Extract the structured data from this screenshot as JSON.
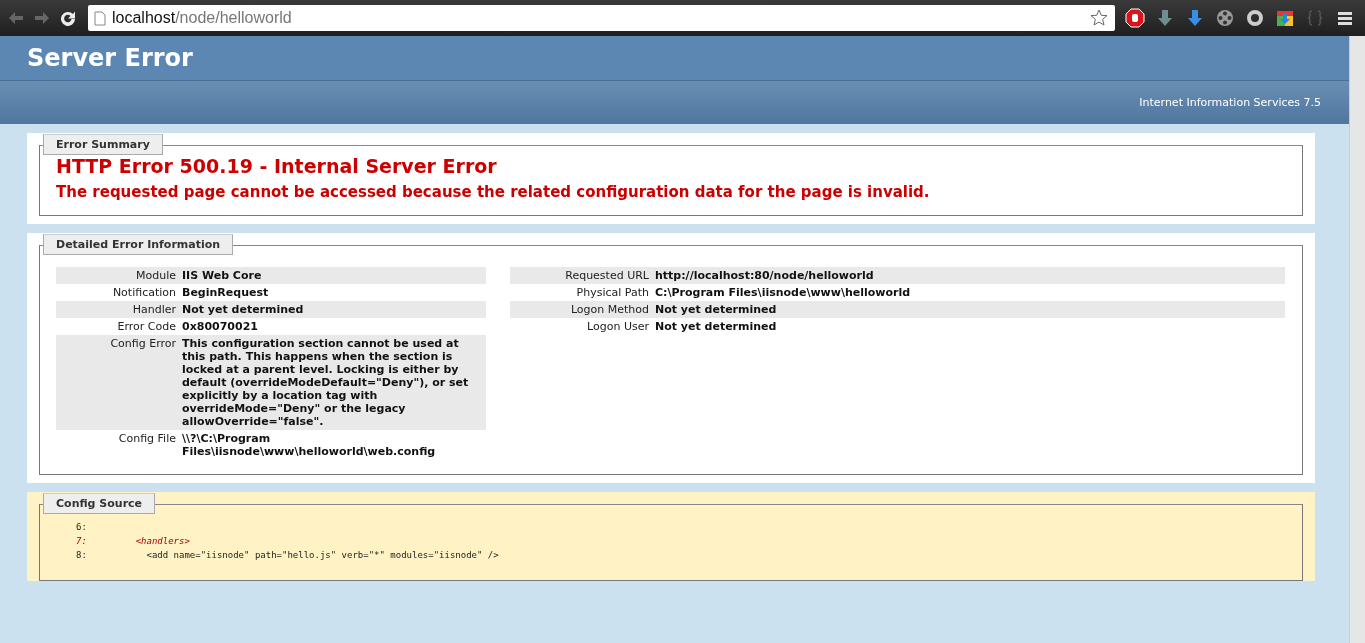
{
  "browser": {
    "url_host": "localhost",
    "url_path": "/node/helloworld"
  },
  "header": {
    "title": "Server Error",
    "subtitle": "Internet Information Services 7.5"
  },
  "error_summary": {
    "legend": "Error Summary",
    "heading": "HTTP Error 500.19 - Internal Server Error",
    "message": "The requested page cannot be accessed because the related configuration data for the page is invalid."
  },
  "detailed_error": {
    "legend": "Detailed Error Information",
    "left": [
      {
        "label": "Module",
        "value": "IIS Web Core"
      },
      {
        "label": "Notification",
        "value": "BeginRequest"
      },
      {
        "label": "Handler",
        "value": "Not yet determined"
      },
      {
        "label": "Error Code",
        "value": "0x80070021"
      },
      {
        "label": "Config Error",
        "value": "This configuration section cannot be used at this path. This happens when the section is locked at a parent level. Locking is either by default (overrideModeDefault=\"Deny\"), or set explicitly by a location tag with overrideMode=\"Deny\" or the legacy allowOverride=\"false\"."
      },
      {
        "label": "Config File",
        "value": "\\\\?\\C:\\Program Files\\iisnode\\www\\helloworld\\web.config"
      }
    ],
    "right": [
      {
        "label": "Requested URL",
        "value": "http://localhost:80/node/helloworld"
      },
      {
        "label": "Physical Path",
        "value": "C:\\Program Files\\iisnode\\www\\helloworld"
      },
      {
        "label": "Logon Method",
        "value": "Not yet determined"
      },
      {
        "label": "Logon User",
        "value": "Not yet determined"
      }
    ]
  },
  "config_source": {
    "legend": "Config Source",
    "lines": [
      {
        "number": "6:",
        "highlighted": false
      },
      {
        "number": "7:",
        "code": "    <handlers>",
        "highlighted": true
      },
      {
        "number": "8:",
        "code": "      <add name=\"iisnode\" path=\"hello.js\" verb=\"*\" modules=\"iisnode\" />",
        "highlighted": false
      }
    ]
  }
}
